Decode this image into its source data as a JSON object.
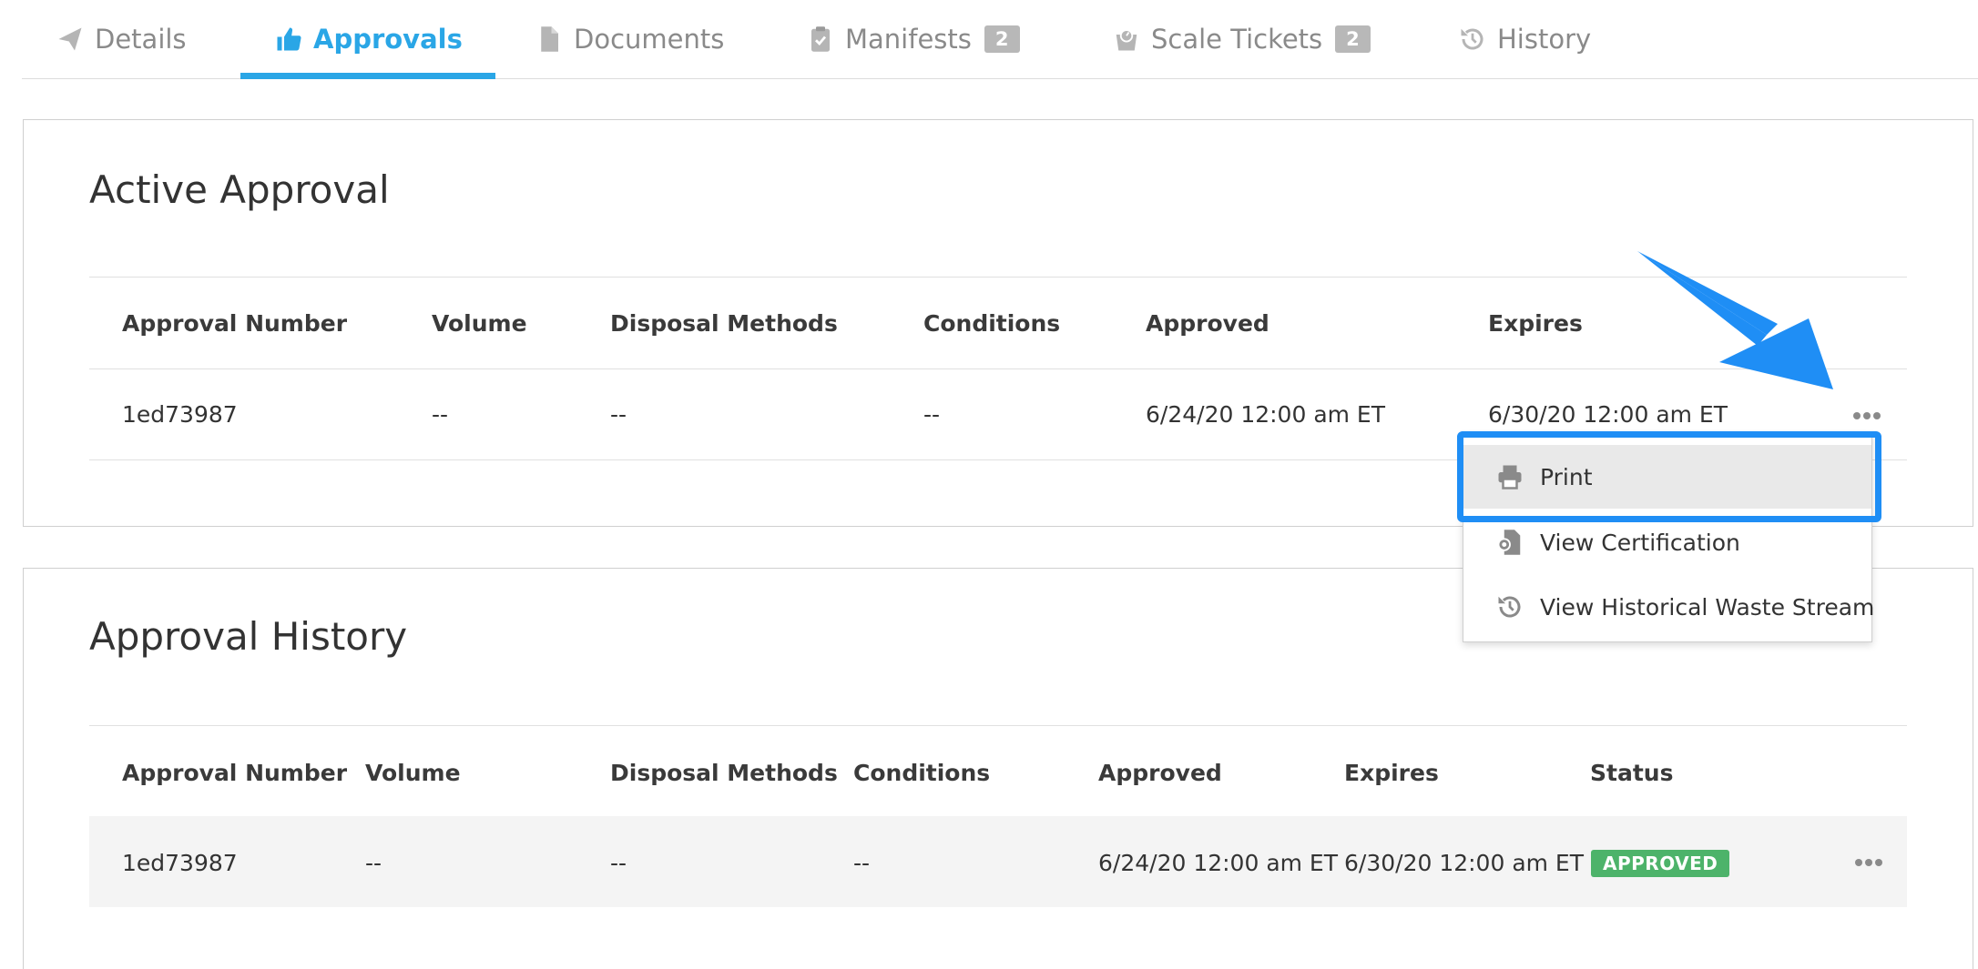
{
  "tabs": [
    {
      "label": "Details",
      "icon": "paper-plane-icon"
    },
    {
      "label": "Approvals",
      "icon": "thumbs-up-icon"
    },
    {
      "label": "Documents",
      "icon": "document-icon"
    },
    {
      "label": "Manifests",
      "icon": "clipboard-check-icon",
      "badge": "2"
    },
    {
      "label": "Scale Tickets",
      "icon": "scale-icon",
      "badge": "2"
    },
    {
      "label": "History",
      "icon": "history-icon"
    }
  ],
  "active_approval": {
    "title": "Active Approval",
    "columns": [
      "Approval Number",
      "Volume",
      "Disposal Methods",
      "Conditions",
      "Approved",
      "Expires"
    ],
    "row": [
      "1ed73987",
      "--",
      "--",
      "--",
      "6/24/20 12:00 am ET",
      "6/30/20 12:00 am ET"
    ]
  },
  "approval_history": {
    "title": "Approval History",
    "columns": [
      "Approval Number",
      "Volume",
      "Disposal Methods",
      "Conditions",
      "Approved",
      "Expires",
      "Status"
    ],
    "row": [
      "1ed73987",
      "--",
      "--",
      "--",
      "6/24/20 12:00 am ET",
      "6/30/20 12:00 am ET"
    ],
    "status": "APPROVED"
  },
  "menu": {
    "items": [
      {
        "label": "Print",
        "icon": "printer-icon"
      },
      {
        "label": "View Certification",
        "icon": "certificate-icon"
      },
      {
        "label": "View Historical Waste Stream",
        "icon": "history-icon"
      }
    ]
  },
  "colors": {
    "accent": "#2aa6e6",
    "status_approved": "#4db36a",
    "highlight": "#1f8ef5"
  }
}
